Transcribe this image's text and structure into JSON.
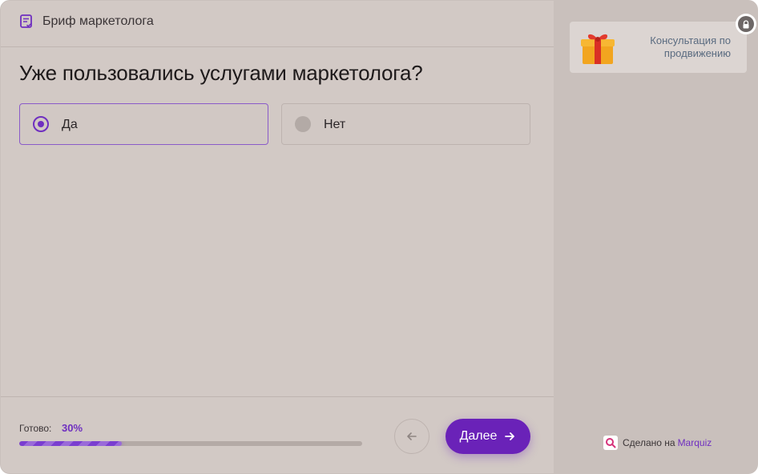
{
  "header": {
    "title": "Бриф маркетолога",
    "icon": "checklist-icon"
  },
  "question": {
    "text": "Уже пользовались услугами маркетолога?",
    "options": [
      {
        "label": "Да",
        "selected": true
      },
      {
        "label": "Нет",
        "selected": false
      }
    ]
  },
  "progress": {
    "label": "Готово:",
    "value_text": "30%",
    "value": 30
  },
  "navigation": {
    "back_icon": "arrow-left-icon",
    "next_label": "Далее",
    "next_icon": "arrow-right-icon"
  },
  "sidebar": {
    "bonus": {
      "text": "Консультация по продвижению",
      "icon": "gift-icon",
      "locked_icon": "lock-icon"
    },
    "footer": {
      "prefix": "Сделано на",
      "brand": "Marquiz",
      "icon": "marquiz-logo-icon"
    }
  },
  "colors": {
    "accent": "#6a22b8",
    "background": "#d2c9c5",
    "sidebar": "#c9c0bc",
    "bonus_text": "#5a6b80"
  }
}
